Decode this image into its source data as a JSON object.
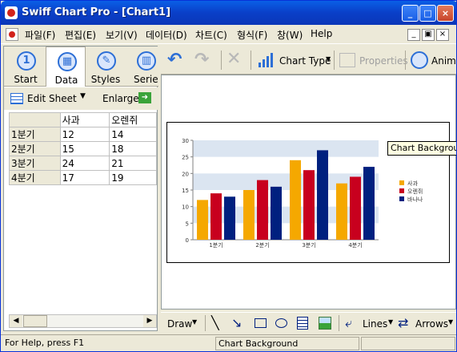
{
  "window": {
    "title": "Swiff Chart Pro - [Chart1]",
    "min": "_",
    "max": "□",
    "close": "×"
  },
  "menu": {
    "items": [
      "파일(F)",
      "편집(E)",
      "보기(V)",
      "데이터(D)",
      "차트(C)",
      "형식(F)",
      "창(W)",
      "Help"
    ],
    "mdi_min": "_",
    "mdi_restore": "▣",
    "mdi_close": "×"
  },
  "left_tabs": {
    "start": "Start",
    "data": "Data",
    "styles": "Styles",
    "series": "Series"
  },
  "sheet_tool": {
    "edit_sheet": "Edit Sheet",
    "enlarge": "Enlarge"
  },
  "sheet": {
    "headers": [
      "",
      "사과",
      "오렌쥐"
    ],
    "rows": [
      [
        "1분기",
        "12",
        "14"
      ],
      [
        "2분기",
        "15",
        "18"
      ],
      [
        "3분기",
        "24",
        "21"
      ],
      [
        "4분기",
        "17",
        "19"
      ]
    ]
  },
  "right_tool": {
    "chart_type": "Chart Type",
    "properties": "Properties",
    "animate": "Anima"
  },
  "tooltip": "Chart Background",
  "draw_tool": {
    "draw": "Draw",
    "lines": "Lines",
    "arrows": "Arrows"
  },
  "status": {
    "help": "For Help, press F1",
    "context": "Chart Background"
  },
  "chart_data": {
    "type": "bar",
    "categories": [
      "1분기",
      "2분기",
      "3분기",
      "4분기"
    ],
    "series": [
      {
        "name": "사과",
        "values": [
          12,
          15,
          24,
          17
        ],
        "color": "#f5a800"
      },
      {
        "name": "오렌쥐",
        "values": [
          14,
          18,
          21,
          19
        ],
        "color": "#c8001e"
      },
      {
        "name": "바나나",
        "values": [
          13,
          16,
          27,
          22
        ],
        "color": "#00207f"
      }
    ],
    "yticks": [
      "0",
      "5",
      "10",
      "15",
      "20",
      "25",
      "30"
    ],
    "ylim": [
      0,
      30
    ],
    "grid_band_color": "#dbe5f1",
    "legend": "right"
  }
}
